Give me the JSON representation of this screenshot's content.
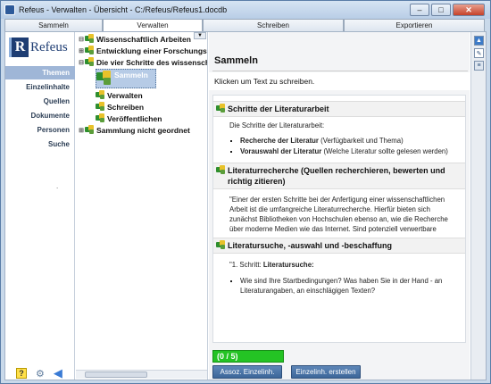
{
  "window": {
    "title": "Refeus - Verwalten - Übersicht - C:/Refeus/Refeus1.docdb",
    "minimize": "–",
    "maximize": "□",
    "close": "✕"
  },
  "tabs": [
    {
      "label": "Sammeln"
    },
    {
      "label": "Verwalten"
    },
    {
      "label": "Schreiben"
    },
    {
      "label": "Exportieren"
    }
  ],
  "logo": {
    "mark": "R",
    "text": "Refeus"
  },
  "nav": [
    "Themen",
    "Einzelinhalte",
    "Quellen",
    "Dokumente",
    "Personen",
    "Suche"
  ],
  "nav_dot": ".",
  "left_bottom": {
    "help": "?",
    "gear": "⚙",
    "back": "◀"
  },
  "tree": [
    {
      "label": "Wissenschaftlich Arbeiten",
      "expander": "⊟"
    },
    {
      "label": "Entwicklung einer Forschungsf",
      "expander": "⊞"
    },
    {
      "label": "Die vier Schritte des wissensch",
      "expander": "⊟"
    },
    {
      "label": "Sammeln",
      "expander": ""
    },
    {
      "label": "Verwalten",
      "expander": ""
    },
    {
      "label": "Schreiben",
      "expander": ""
    },
    {
      "label": "Veröffentlichen",
      "expander": ""
    },
    {
      "label": "Sammlung nicht geordnet",
      "expander": "⊞"
    }
  ],
  "main": {
    "title": "Sammeln",
    "subtitle": "Klicken um Text zu schreiben."
  },
  "sections": [
    {
      "heading": "Schritte der Literaturarbeit",
      "intro": "Die Schritte der Literaturarbeit:",
      "items": [
        {
          "bold": "Recherche der Literatur",
          "rest": " (Verfügbarkeit und Thema)"
        },
        {
          "bold": "Vorauswahl der Literatur",
          "rest": " (Welche Literatur sollte gelesen werden)"
        }
      ]
    },
    {
      "heading": "Literaturrecherche (Quellen recherchieren, bewerten und richtig zitieren)",
      "text": "\"Einer der ersten Schritte bei der Anfertigung einer wissenschaftlichen Arbeit ist die umfangreiche Literaturrecherche. Hierfür bieten sich zunächst Bibliotheken von Hochschulen ebenso an, wie die Recherche über moderne Medien wie das Internet. Sind potenziell verwertbare Quellen identifiziert,"
    },
    {
      "heading": "Literatursuche, -auswahl und -beschaffung",
      "intro_prefix": "\"1. Schritt: ",
      "intro_bold": "Literatursuche:",
      "items": [
        {
          "bold": "",
          "rest": "Wie sind Ihre Startbedingungen? Was haben Sie in der Hand - an Literaturangaben, an einschlägigen Texten?"
        }
      ]
    }
  ],
  "progress": {
    "label": "(0 / 5)"
  },
  "buttons": {
    "assoc": "Assoz. Einzelinh.",
    "create": "Einzelinh. erstellen"
  },
  "right_tools": {
    "up": "▲",
    "edit": "✎",
    "list": "≡"
  },
  "colors": {
    "accent": "#3c6699",
    "progress": "#24c324",
    "selection": "#b6cbe6"
  }
}
